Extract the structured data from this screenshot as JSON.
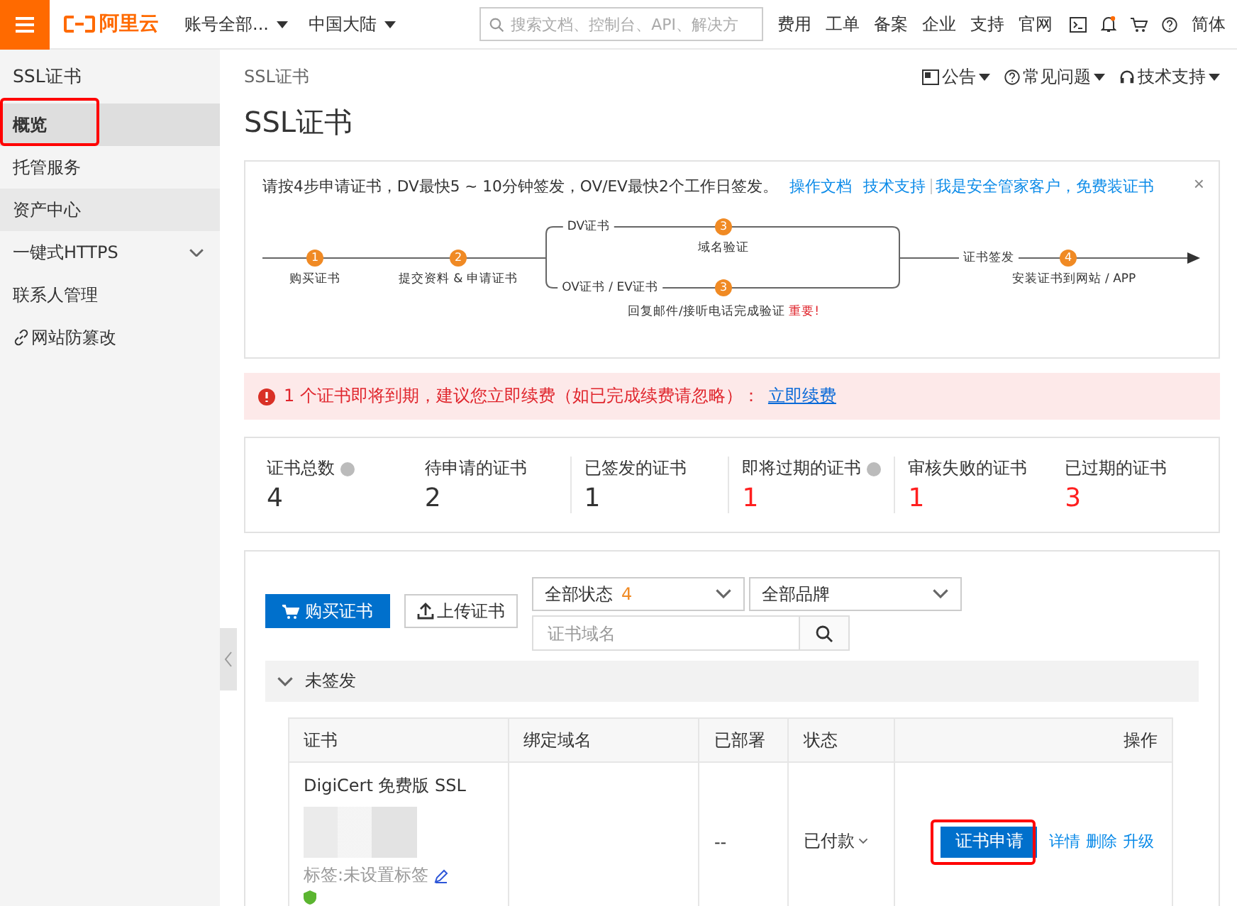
{
  "topbar": {
    "logo": "阿里云",
    "account": "账号全部...",
    "region": "中国大陆",
    "search": {
      "placeholder": "搜索文档、控制台、API、解决方"
    },
    "nav": [
      "费用",
      "工单",
      "备案",
      "企业",
      "支持",
      "官网"
    ],
    "language": "简体"
  },
  "sidebar": {
    "title": "SSL证书",
    "items": [
      {
        "label": "概览",
        "kind": "item",
        "selected": true,
        "hovered": false,
        "annotated": true
      },
      {
        "label": "托管服务",
        "kind": "item",
        "selected": false,
        "hovered": false,
        "annotated": false
      },
      {
        "label": "资产中心",
        "kind": "item",
        "selected": false,
        "hovered": true,
        "annotated": false
      },
      {
        "label": "一键式HTTPS",
        "kind": "group",
        "selected": false,
        "hovered": false,
        "annotated": false
      },
      {
        "label": "联系人管理",
        "kind": "item",
        "selected": false,
        "hovered": false,
        "annotated": false
      },
      {
        "label": "网站防篡改",
        "kind": "linked",
        "selected": false,
        "hovered": false,
        "annotated": false
      }
    ]
  },
  "breadcrumb": "SSL证书",
  "header_links": [
    {
      "label": "公告",
      "kind": "notice"
    },
    {
      "label": "常见问题",
      "kind": "help"
    },
    {
      "label": "技术支持",
      "kind": "support"
    }
  ],
  "title": "SSL证书",
  "guide": {
    "text": "请按4步申请证书，DV最快5 ~ 10分钟签发，OV/EV最快2个工作日签发。",
    "links": [
      "操作文档",
      "技术支持"
    ],
    "security_link": "我是安全管家客户，免费装证书",
    "close": "×",
    "steps": {
      "step1": {
        "number": "1",
        "label": "购买证书"
      },
      "step2": {
        "number": "2",
        "label": "提交资料 & 申请证书"
      },
      "dv": {
        "branch": "DV证书",
        "number": "3",
        "label": "域名验证"
      },
      "ov": {
        "branch": "OV证书 / EV证书",
        "number": "3",
        "label": "回复邮件/接听电话完成验证",
        "important": "重要!"
      },
      "issue": "证书签发",
      "step4": {
        "number": "4",
        "label": "安装证书到网站 / APP"
      }
    }
  },
  "alert": {
    "text": "1 个证书即将到期，建议您立即续费（如已完成续费请忽略）：",
    "link": "立即续费"
  },
  "stats": [
    {
      "label": "证书总数",
      "value": "4",
      "help": true,
      "alert": false
    },
    {
      "label": "待申请的证书",
      "value": "2",
      "help": false,
      "alert": false
    },
    {
      "label": "已签发的证书",
      "value": "1",
      "help": false,
      "alert": false
    },
    {
      "label": "即将过期的证书",
      "value": "1",
      "help": true,
      "alert": true
    },
    {
      "label": "审核失败的证书",
      "value": "1",
      "help": false,
      "alert": true
    },
    {
      "label": "已过期的证书",
      "value": "3",
      "help": false,
      "alert": true
    }
  ],
  "toolbar": {
    "buy_button": "购买证书",
    "upload_button": "上传证书",
    "status_select": {
      "label": "全部状态",
      "count": "4"
    },
    "brand_select": "全部品牌",
    "search": {
      "placeholder": "证书域名"
    }
  },
  "group": {
    "title": "未签发",
    "expanded": true
  },
  "table": {
    "columns": [
      "证书",
      "绑定域名",
      "已部署",
      "状态",
      "操作"
    ],
    "rows": [
      {
        "cert_name": "DigiCert 免费版 SSL",
        "tag": "标签:未设置标签",
        "deployed": "--",
        "status": "已付款",
        "primary_action": "证书申请",
        "annotated": true,
        "actions": [
          "详情",
          "删除",
          "升级"
        ]
      }
    ]
  }
}
